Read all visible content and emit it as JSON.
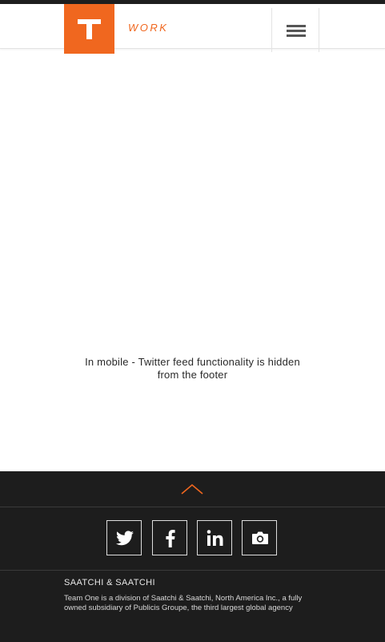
{
  "header": {
    "logo_letter": "T",
    "section_title": "WORK",
    "menu_icon": "hamburger-menu-icon",
    "accent_color": "#f0671f"
  },
  "main": {
    "note": "In mobile - Twitter feed functionality is hidden from the footer"
  },
  "footer": {
    "back_to_top_icon": "chevron-up-icon",
    "social": [
      {
        "name": "twitter",
        "icon": "twitter-icon"
      },
      {
        "name": "facebook",
        "icon": "facebook-icon"
      },
      {
        "name": "linkedin",
        "icon": "linkedin-icon"
      },
      {
        "name": "instagram",
        "icon": "camera-icon"
      }
    ],
    "company_name": "SAATCHI & SAATCHI",
    "company_description": "Team One is a division of Saatchi & Saatchi, North America Inc., a fully owned subsidiary of Publicis Groupe, the third largest global agency",
    "background_color": "#1d1d1d"
  }
}
